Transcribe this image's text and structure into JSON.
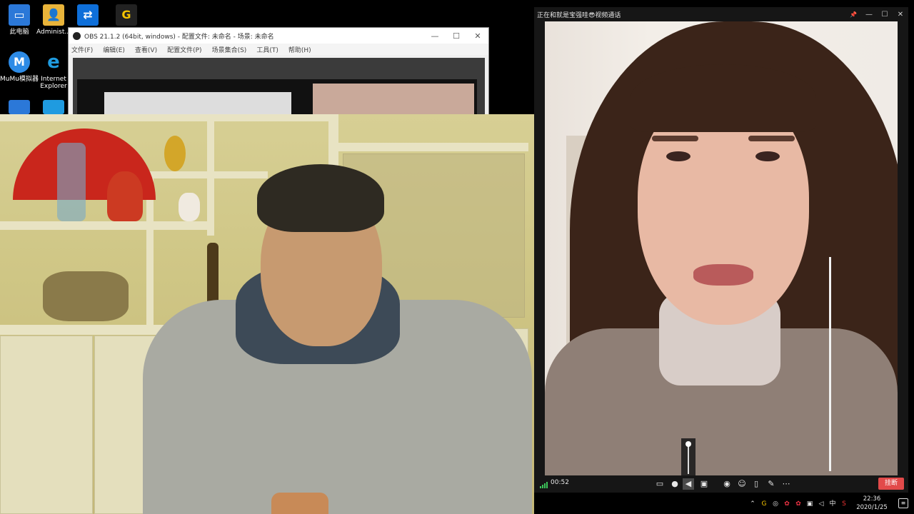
{
  "desktop": {
    "icons": [
      {
        "label": "此电脑",
        "icon": "computer-icon",
        "color": "#2b78d8"
      },
      {
        "label": "Administ...",
        "icon": "user-folder-icon",
        "color": "#e9b43a"
      },
      {
        "label": "",
        "icon": "teamviewer-icon",
        "color": "#0e6fd9"
      },
      {
        "label": "",
        "icon": "g-app-icon",
        "color": "#222222"
      },
      {
        "label": "MuMu模拟器",
        "icon": "mumu-emulator-icon",
        "color": "#2d8be6"
      },
      {
        "label": "Internet Explorer",
        "icon": "ie-icon",
        "color": "#1f9be0"
      }
    ]
  },
  "obs": {
    "title": "OBS 21.1.2 (64bit, windows) - 配置文件: 未命名 - 场景: 未命名",
    "menu": [
      "文件(F)",
      "编辑(E)",
      "查看(V)",
      "配置文件(P)",
      "场景集合(S)",
      "工具(T)",
      "帮助(H)"
    ],
    "controls": {
      "minimize": "—",
      "maximize": "☐",
      "close": "✕"
    }
  },
  "call": {
    "title": "正在和就是宝强哇😎视频通话",
    "controls": {
      "pin": "📌",
      "minimize": "—",
      "maximize": "☐",
      "close": "✕"
    },
    "timer": "00:52",
    "hangup_label": "挂断",
    "volume_level": 1.0,
    "toolbar_icons": [
      "message-icon",
      "microphone-icon",
      "speaker-icon",
      "camera-off-icon",
      "screenshot-icon",
      "robot-icon",
      "screen-share-icon",
      "edit-icon",
      "more-icon"
    ]
  },
  "taskbar": {
    "time": "22:36",
    "date": "2020/1/25",
    "ime": "中",
    "tray_icons": [
      "chevron-up-icon",
      "g-tray-icon",
      "chrome-tray-icon",
      "app-tray-icon",
      "app2-tray-icon",
      "network-icon",
      "volume-icon",
      "ime-icon",
      "sogou-icon",
      "notification-icon"
    ]
  }
}
